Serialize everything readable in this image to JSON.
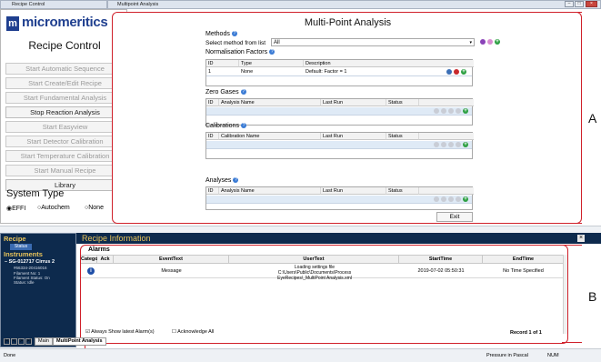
{
  "left_window": {
    "title": "Recipe Control",
    "logo_text": "micromeritics",
    "heading": "Recipe Control",
    "buttons": [
      "Start Automatic Sequence",
      "Start Create/Edit Recipe",
      "Start Fundamental Analysis",
      "Stop Reaction Analysis",
      "Start Easyview",
      "Start Detector Calibration",
      "Start Temperature Calibration",
      "Start Manual Recipe",
      "Library"
    ],
    "active_buttons": [
      3,
      8
    ],
    "system_type_label": "System Type",
    "system_types": [
      "EFFI",
      "Autochem",
      "None"
    ],
    "system_type_selected": "EFFI"
  },
  "main_window": {
    "title": "Multipoint Analysis",
    "heading": "Multi-Point Analysis",
    "methods_label": "Methods",
    "select_method_label": "Select method from list",
    "select_method_value": "All",
    "normalisation_label": "Normalisation Factors",
    "norm_headers": [
      "ID",
      "Type",
      "Description"
    ],
    "norm_row": [
      "1",
      "None",
      "Default: Factor = 1"
    ],
    "zero_gases_label": "Zero Gases",
    "zero_headers": [
      "ID",
      "Analysis Name",
      "Last Run",
      "Status"
    ],
    "calibrations_label": "Calibrations",
    "cal_headers": [
      "ID",
      "Calibration Name",
      "Last Run",
      "Status"
    ],
    "analyses_label": "Analyses",
    "analyses_headers": [
      "ID",
      "Analysis Name",
      "Last Run",
      "Status"
    ],
    "exit_label": "Exit"
  },
  "bottom_window": {
    "recipe_label": "Recipe",
    "status_label": "Status",
    "instruments_label": "Instruments",
    "instrument_name": "SG-012717 Cirrus 2",
    "instrument_id": "#66334-20416016",
    "instrument_lines": [
      "Filament No: 1",
      "Filament Status: On",
      "Status: Idle"
    ],
    "recipe_info_title": "Recipe Information",
    "alarms_label": "Alarms",
    "alarm_headers": [
      "Category",
      "Ack",
      "EventText",
      "UserText",
      "StartTime",
      "EndTime"
    ],
    "alarm_row": {
      "event": "Message",
      "user_text": "Loading settings file C:\\Users\\Public\\Documents\\Process EyeRecipes\\_MultiPoint Analysis.xml",
      "start": "2019-07-02 05:50:31",
      "end": "No Time Specified"
    },
    "always_show_label": "Always Show latest Alarm(s)",
    "acknowledge_label": "Acknowledge All",
    "record_label": "Record 1 of 1",
    "tabs": [
      "Main",
      "MultiPoint Analysis"
    ]
  },
  "status_bar": {
    "left": "Done",
    "pressure": "Pressure in Pascal",
    "num": "NUM"
  },
  "callouts": [
    "A",
    "B"
  ],
  "colors": {
    "accent_red": "#d0202a",
    "navy": "#0d2a4d",
    "recipe_gold": "#e8c35a",
    "grid_row": "#dfeaf6"
  }
}
